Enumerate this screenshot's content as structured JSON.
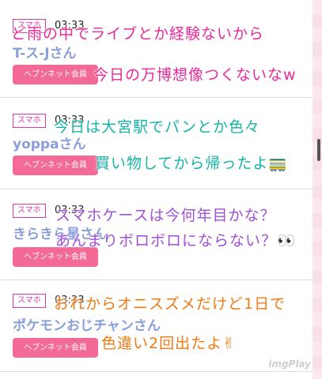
{
  "posts": [
    {
      "device": "スマホ",
      "time": "03:33",
      "username": "T-ス-Jさん",
      "member_label": "ヘブンネット会員",
      "overlay_lines": [
        "ど雨の中でライブとか経験ないから",
        "今日の万博想像つくないなw"
      ],
      "overlay_color": "#e8299a"
    },
    {
      "device": "スマホ",
      "time": "03:33",
      "username": "yoppaさん",
      "member_label": "ヘブンネット会員",
      "overlay_lines": [
        "今日は大宮駅でパンとか色々",
        "買い物してから帰ったよ🚃"
      ],
      "overlay_color": "#17b3a8"
    },
    {
      "device": "スマホ",
      "time": "03:33",
      "username": "きらきら星さん",
      "member_label": "ヘブンネット会員",
      "overlay_lines": [
        "スマホケースは今何年目かな？",
        "あんまりボロボロにならない？👀"
      ],
      "overlay_color": "#a050d8"
    },
    {
      "device": "スマホ",
      "time": "03:33",
      "username": "ポケモンおじチャンさん",
      "member_label": "ヘブンネット会員",
      "overlay_lines": [
        "おれからオニスズメだけど1日で",
        "色違い2回出たよ✌"
      ],
      "overlay_color": "#f07a12"
    }
  ],
  "watermark": "imgPlay"
}
